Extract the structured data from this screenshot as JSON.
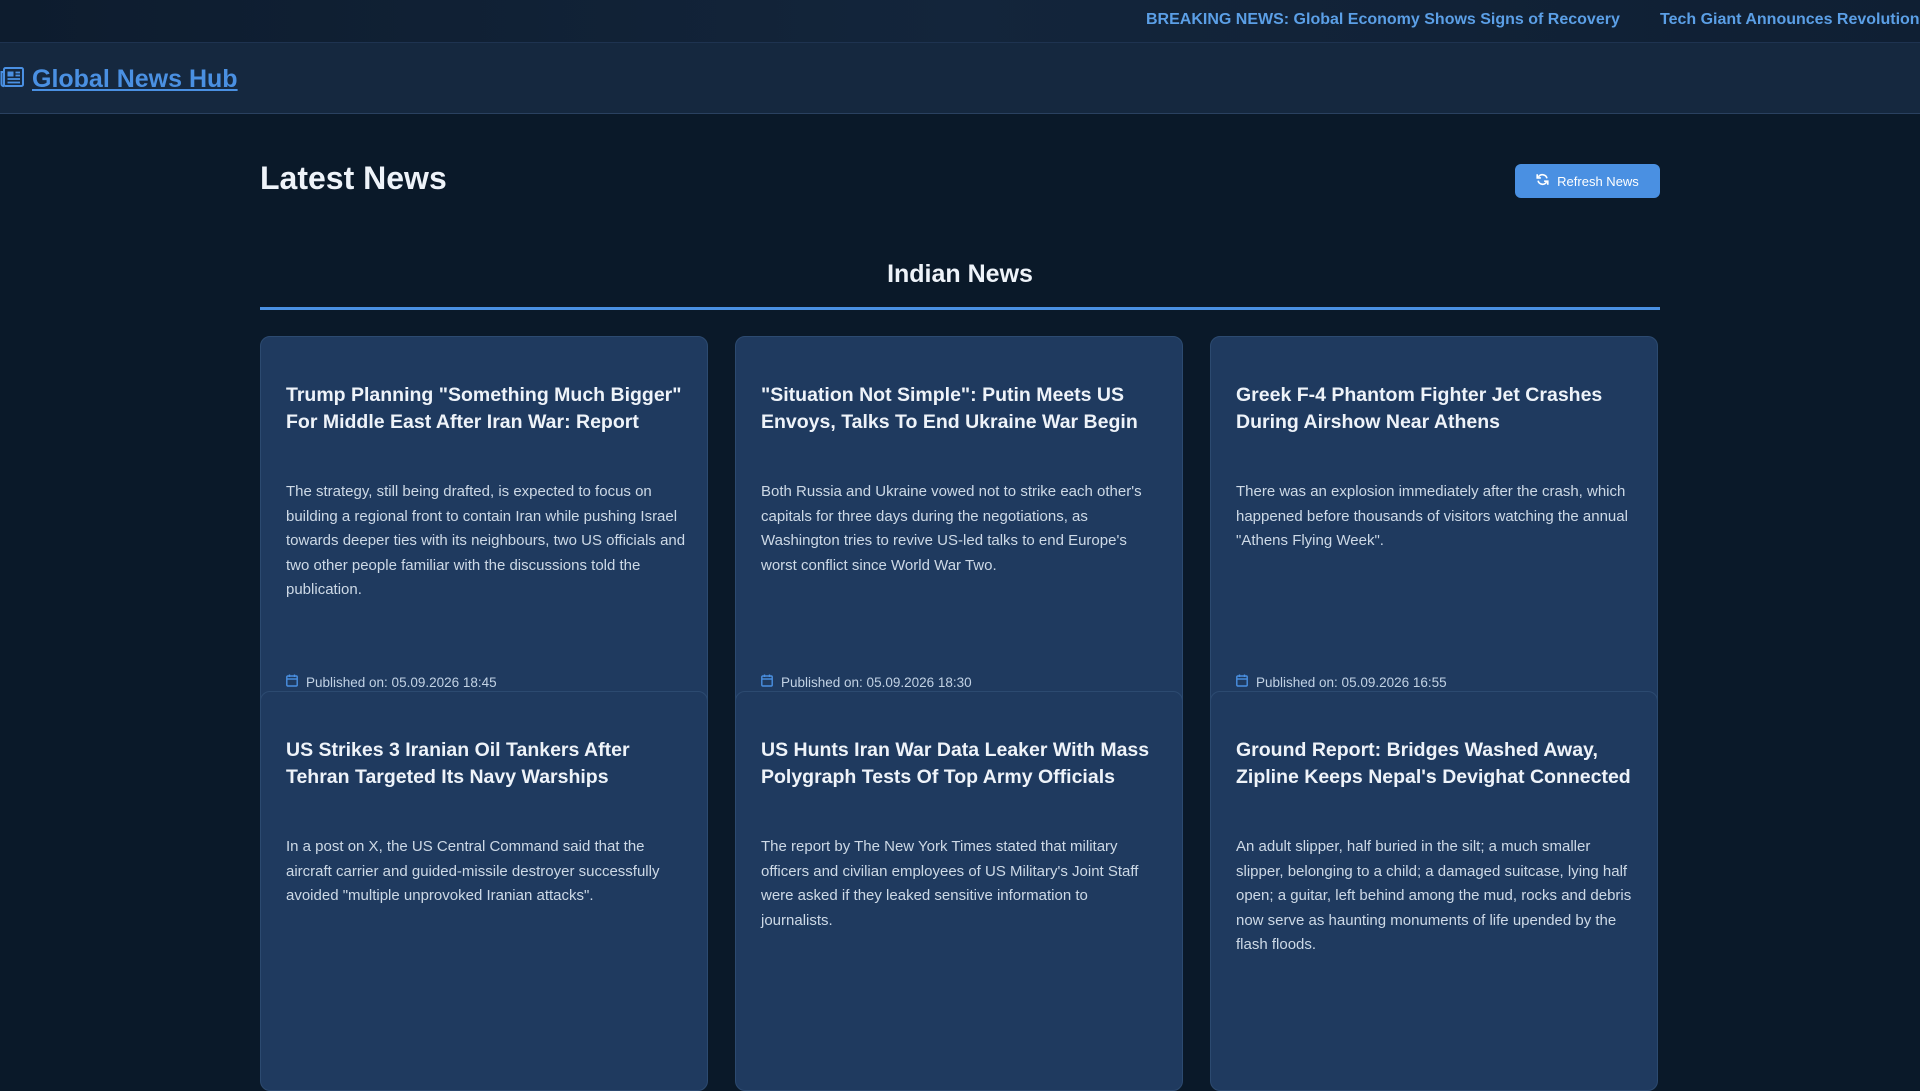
{
  "ticker": {
    "items": [
      "BREAKING NEWS: Global Economy Shows Signs of Recovery",
      "Tech Giant Announces Revolution"
    ]
  },
  "header": {
    "brand": "Global News Hub",
    "brand_icon": "newspaper-icon"
  },
  "main": {
    "title": "Latest News",
    "refresh_label": "Refresh News",
    "refresh_icon": "refresh-icon",
    "section_title": "Indian News"
  },
  "articles": [
    {
      "title": "Trump Planning \"Something Much Bigger\" For Middle East After Iran War: Report",
      "description": "The strategy, still being drafted, is expected to focus on building a regional front to contain Iran while pushing Israel towards deeper ties with its neighbours, two US officials and two other people familiar with the discussions told the publication.",
      "published": "Published on: 05.09.2026 18:45"
    },
    {
      "title": "\"Situation Not Simple\": Putin Meets US Envoys, Talks To End Ukraine War Begin",
      "description": "Both Russia and Ukraine vowed not to strike each other's capitals for three days during the negotiations, as Washington tries to revive US-led talks to end Europe's worst conflict since World War Two.",
      "published": "Published on: 05.09.2026 18:30"
    },
    {
      "title": "Greek F-4 Phantom Fighter Jet Crashes During Airshow Near Athens",
      "description": "There was an explosion immediately after the crash, which happened before thousands of visitors watching the annual \"Athens Flying Week\".",
      "published": "Published on: 05.09.2026 16:55"
    },
    {
      "title": "US Strikes 3 Iranian Oil Tankers After Tehran Targeted Its Navy Warships",
      "description": "In a post on X, the US Central Command said that the aircraft carrier and guided-missile destroyer successfully avoided \"multiple unprovoked Iranian attacks\".",
      "published": ""
    },
    {
      "title": "US Hunts Iran War Data Leaker With Mass Polygraph Tests Of Top Army Officials",
      "description": "The report by The New York Times stated that military officers and civilian employees of US Military's Joint Staff were asked if they leaked sensitive information to journalists.",
      "published": ""
    },
    {
      "title": "Ground Report: Bridges Washed Away, Zipline Keeps Nepal's Devighat Connected",
      "description": "An adult slipper, half buried in the silt; a much smaller slipper, belonging to a child; a damaged suitcase, lying half open; a guitar, left behind among the mud, rocks and debris now serve as haunting monuments of life upended by the flash floods.",
      "published": ""
    }
  ]
}
